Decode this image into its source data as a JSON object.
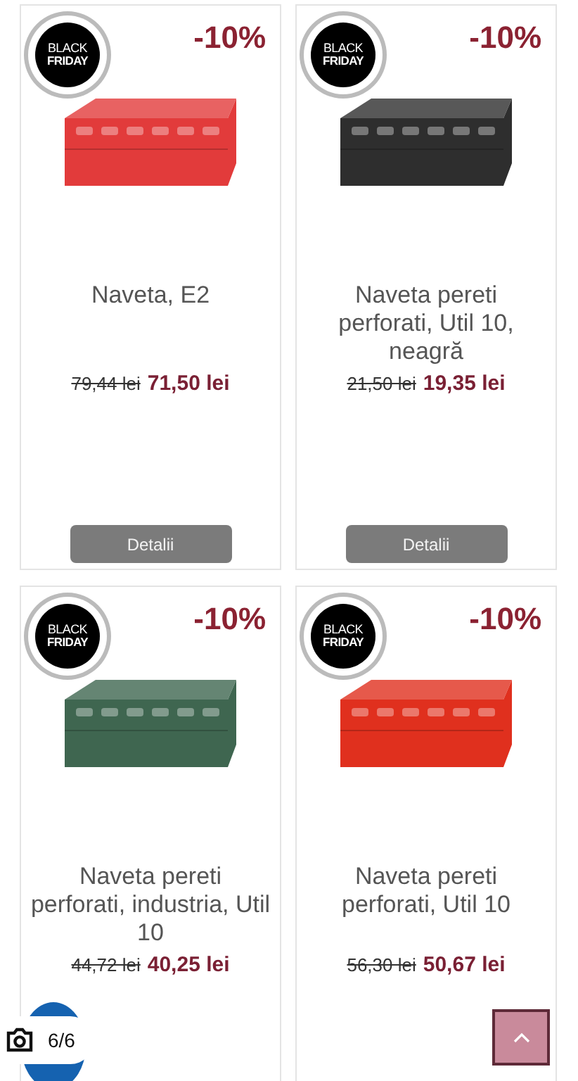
{
  "products": [
    {
      "badge": [
        "BLACK",
        "FRIDAY"
      ],
      "discount": "-10%",
      "color": "#e23b3b",
      "name": "Naveta, E2",
      "old_price": "79,44 lei",
      "price": "71,50 lei",
      "button": "Detalii"
    },
    {
      "badge": [
        "BLACK",
        "FRIDAY"
      ],
      "discount": "-10%",
      "color": "#2e2e2e",
      "name": "Naveta pereti perforati, Util 10, neagră",
      "old_price": "21,50 lei",
      "price": "19,35 lei",
      "button": "Detalii"
    },
    {
      "badge": [
        "BLACK",
        "FRIDAY"
      ],
      "discount": "-10%",
      "color": "#3f6650",
      "name": "Naveta pereti perforati, industria, Util 10",
      "old_price": "44,72 lei",
      "price": "40,25 lei"
    },
    {
      "badge": [
        "BLACK",
        "FRIDAY"
      ],
      "discount": "-10%",
      "color": "#e0301e",
      "name": "Naveta pereti perforati, Util 10",
      "old_price": "56,30 lei",
      "price": "50,67 lei"
    }
  ],
  "photo_counter": "6/6"
}
